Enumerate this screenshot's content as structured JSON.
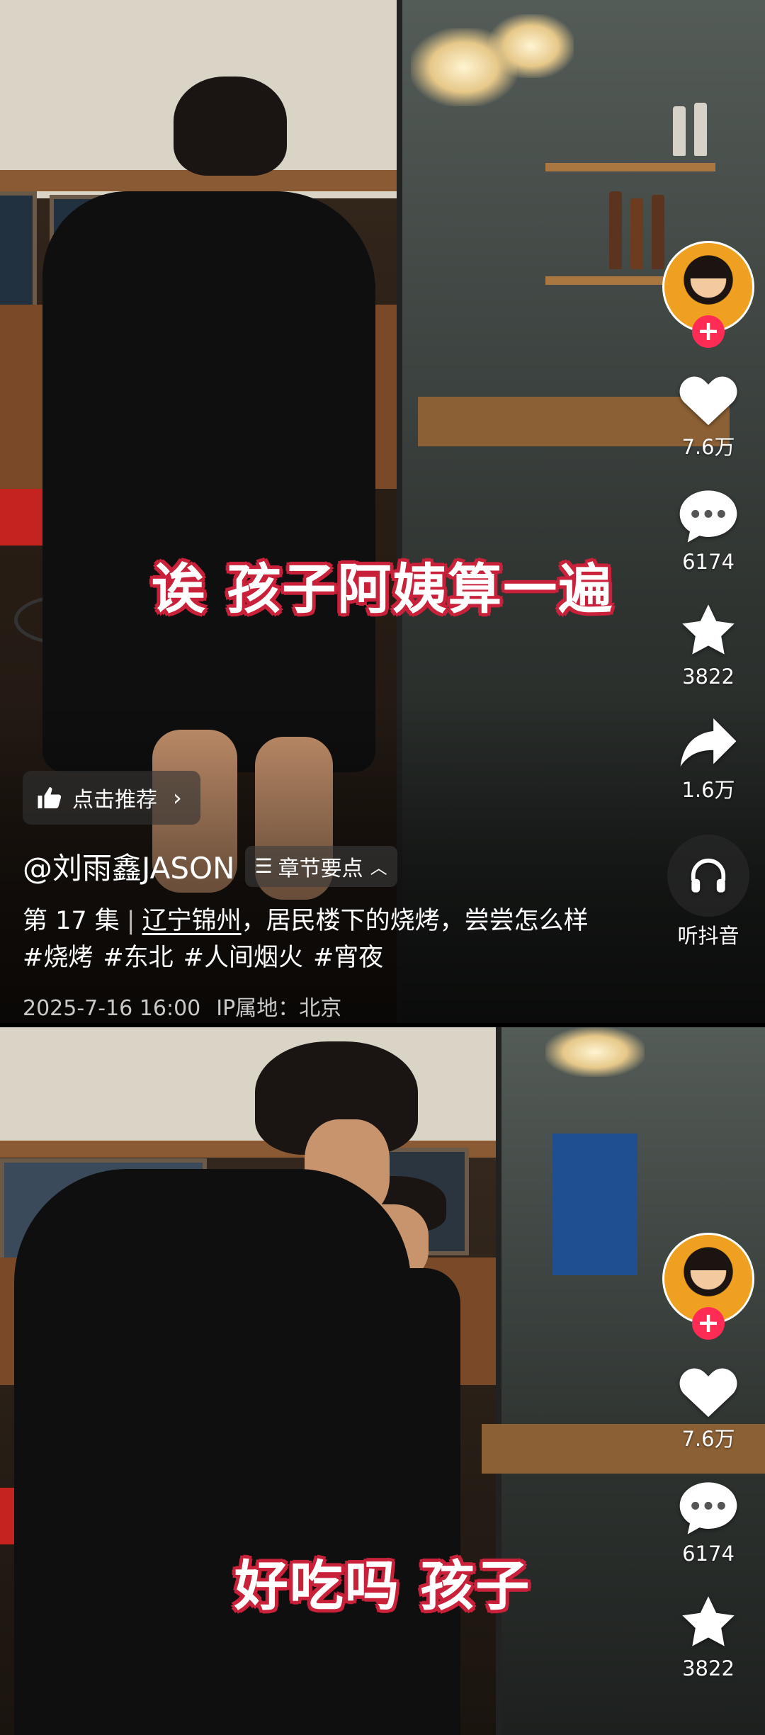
{
  "frames": [
    {
      "subtitle": "诶 孩子阿姨算一遍",
      "actions": {
        "likes": "7.6万",
        "comments": "6174",
        "favorites": "3822",
        "shares": "1.6万",
        "listen_label": "听抖音"
      },
      "recommend": {
        "label": "点击推荐"
      },
      "author": "@刘雨鑫JASON",
      "chapters_label": "章节要点",
      "description": {
        "episode": "第 17 集",
        "location": "辽宁锦州",
        "text": "，居民楼下的烧烤，尝尝怎么样",
        "tags": [
          "#烧烤",
          "#东北",
          "#人间烟火",
          "#宵夜"
        ]
      },
      "meta": {
        "timestamp": "2025-7-16 16:00",
        "ip": "IP属地：北京"
      }
    },
    {
      "subtitle": "好吃吗 孩子",
      "actions": {
        "likes": "7.6万",
        "comments": "6174",
        "favorites": "3822"
      }
    }
  ],
  "colors": {
    "accent": "#fe2c55",
    "subtitle_outline": "#c9213a",
    "avatar_bg": "#f0a020"
  }
}
